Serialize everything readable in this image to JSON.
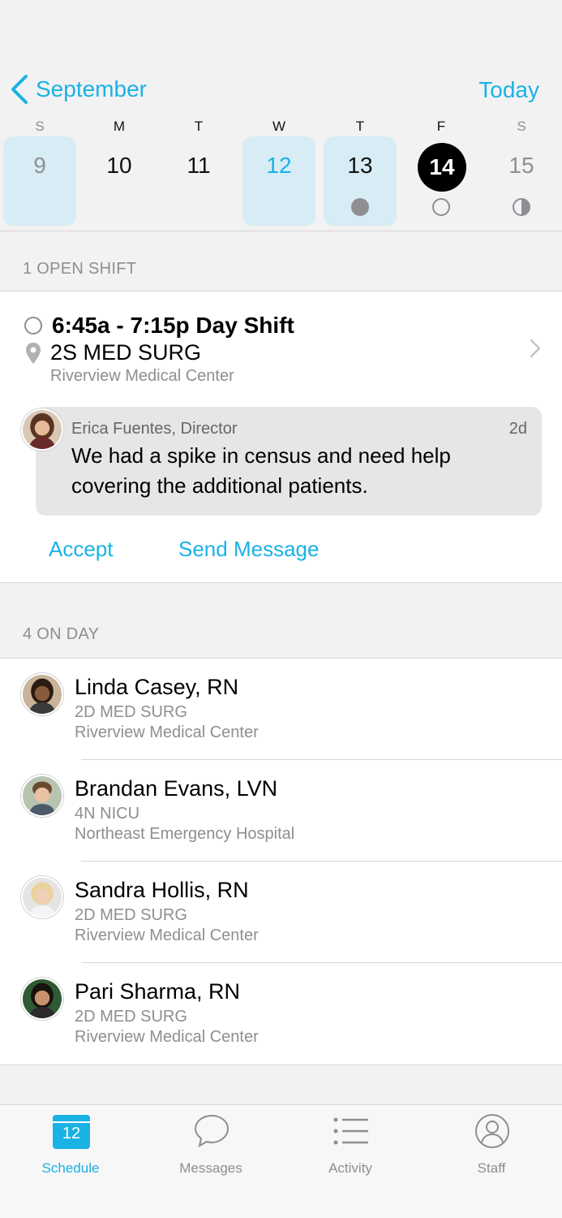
{
  "header": {
    "back_label": "September",
    "today_label": "Today"
  },
  "week": [
    {
      "dow": "S",
      "date": "9"
    },
    {
      "dow": "M",
      "date": "10"
    },
    {
      "dow": "T",
      "date": "11"
    },
    {
      "dow": "W",
      "date": "12"
    },
    {
      "dow": "T",
      "date": "13"
    },
    {
      "dow": "F",
      "date": "14"
    },
    {
      "dow": "S",
      "date": "15"
    }
  ],
  "open_shift": {
    "section_label": "1 OPEN SHIFT",
    "title": "6:45a - 7:15p Day Shift",
    "unit": "2S MED SURG",
    "facility": "Riverview Medical Center",
    "message": {
      "author": "Erica Fuentes, Director",
      "age": "2d",
      "text": "We had a spike in census and need help covering the additional patients."
    },
    "accept_label": "Accept",
    "send_message_label": "Send Message"
  },
  "on_day": {
    "section_label": "4 ON DAY",
    "staff": [
      {
        "name": "Linda Casey, RN",
        "unit": "2D MED SURG",
        "facility": "Riverview Medical Center"
      },
      {
        "name": "Brandan Evans, LVN",
        "unit": "4N NICU",
        "facility": "Northeast Emergency Hospital"
      },
      {
        "name": "Sandra Hollis, RN",
        "unit": "2D MED SURG",
        "facility": "Riverview Medical Center"
      },
      {
        "name": "Pari Sharma, RN",
        "unit": "2D MED SURG",
        "facility": "Riverview Medical Center"
      }
    ]
  },
  "tabs": {
    "calendar_day": "12",
    "items": [
      {
        "label": "Schedule"
      },
      {
        "label": "Messages"
      },
      {
        "label": "Activity"
      },
      {
        "label": "Staff"
      }
    ]
  },
  "colors": {
    "accent": "#1ab2e5",
    "highlight": "#d7ecf4",
    "muted": "#8e8e93"
  }
}
